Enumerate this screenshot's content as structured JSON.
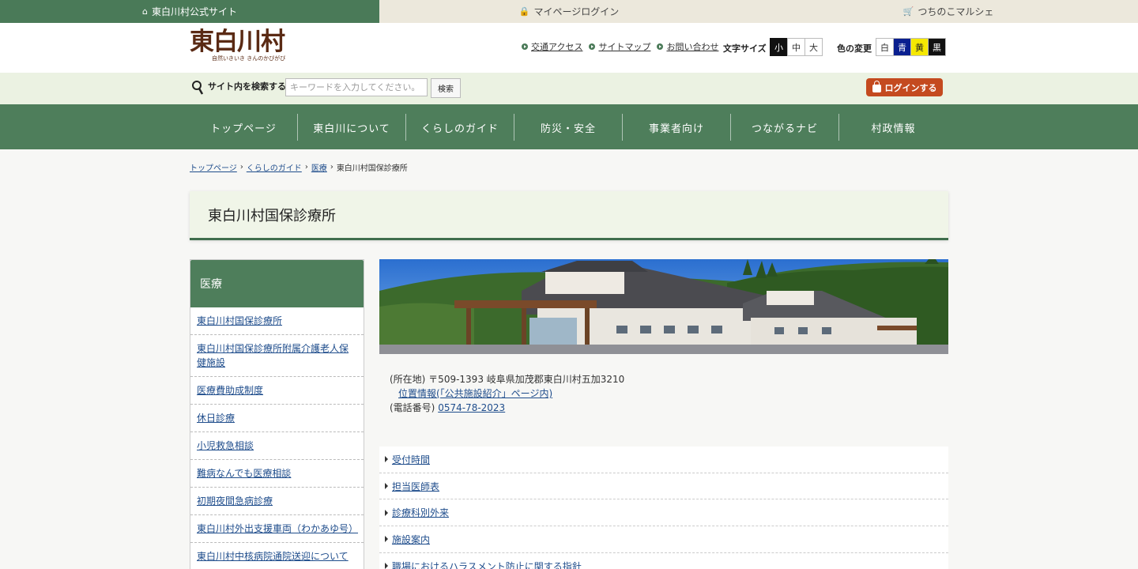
{
  "topbar": {
    "official": "東白川村公式サイト",
    "mypage": "マイページログイン",
    "marche": "つちのこマルシェ"
  },
  "header": {
    "logo_main": "東白川村",
    "logo_sub": "自然いきいき きんのかびがび",
    "links": [
      "交通アクセス",
      "サイトマップ",
      "お問い合わせ"
    ],
    "font_size_label": "文字サイズ",
    "font_sizes": [
      "小",
      "中",
      "大"
    ],
    "color_label": "色の変更",
    "colors": [
      "白",
      "青",
      "黄",
      "黒"
    ]
  },
  "search": {
    "label": "サイト内を検索する",
    "placeholder": "キーワードを入力してください。",
    "button": "検索",
    "login": "ログインする"
  },
  "gnav": [
    "トップページ",
    "東白川について",
    "くらしのガイド",
    "防災・安全",
    "事業者向け",
    "つながるナビ",
    "村政情報"
  ],
  "breadcrumb": [
    "トップページ",
    "くらしのガイド",
    "医療",
    "東白川村国保診療所"
  ],
  "page_title": "東白川村国保診療所",
  "side": {
    "heading": "医療",
    "items": [
      "東白川村国保診療所",
      "東白川村国保診療所附属介護老人保健施設",
      "医療費助成制度",
      "休日診療",
      "小児救急相談",
      "難病なんでも医療相談",
      "初期夜間急病診療",
      "東白川村外出支援車両（わかあゆ号）",
      "東白川村中核病院通院送迎について"
    ]
  },
  "info": {
    "address": "(所在地) 〒509-1393 岐阜県加茂郡東白川村五加3210",
    "location_link": "位置情報(「公共施設紹介」ページ内)",
    "phone_label": "(電話番号) ",
    "phone": "0574-78-2023"
  },
  "links": [
    "受付時間",
    "担当医師表",
    "診療科別外来",
    "施設案内",
    "職場におけるハラスメント防止に関する指針"
  ]
}
